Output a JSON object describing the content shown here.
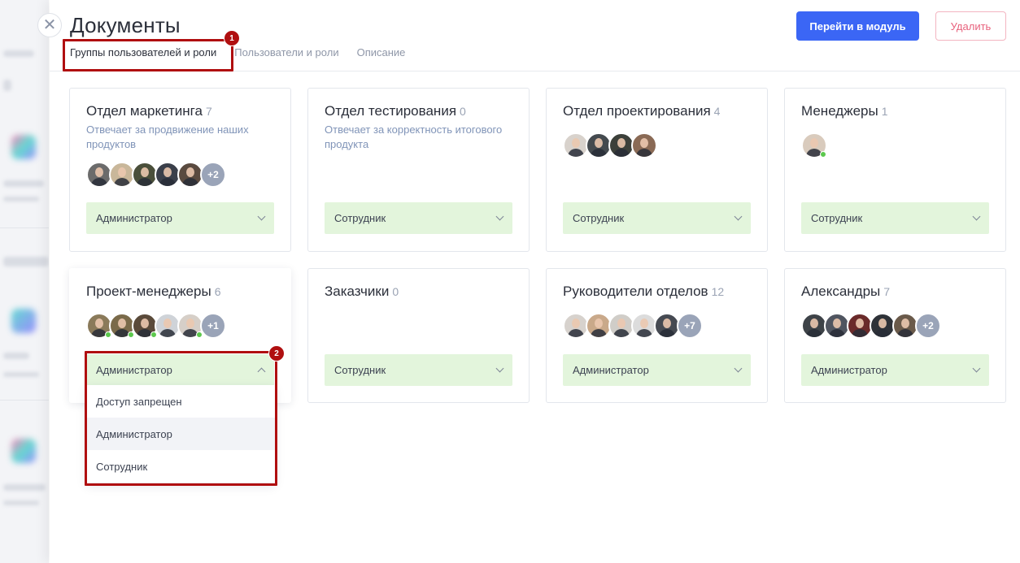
{
  "header": {
    "title": "Документы",
    "primary_button": "Перейти в модуль",
    "delete_button": "Удалить",
    "close_icon": "close-icon"
  },
  "tabs": [
    {
      "label": "Группы пользователей и роли",
      "active": true
    },
    {
      "label": "Пользователи и роли",
      "active": false
    },
    {
      "label": "Описание",
      "active": false
    }
  ],
  "groups": [
    {
      "name": "Отдел маркетинга",
      "count": "7",
      "description": "Отвечает за продвижение наших продуктов",
      "avatars_more": "+2",
      "role": "Администратор"
    },
    {
      "name": "Отдел тестирования",
      "count": "0",
      "description": "Отвечает за корректность итогового продукта",
      "role": "Сотрудник"
    },
    {
      "name": "Отдел проектирования",
      "count": "4",
      "role": "Сотрудник"
    },
    {
      "name": "Менеджеры",
      "count": "1",
      "role": "Сотрудник"
    },
    {
      "name": "Проект-менеджеры",
      "count": "6",
      "avatars_more": "+1",
      "role": "Администратор"
    },
    {
      "name": "Заказчики",
      "count": "0",
      "role": "Сотрудник"
    },
    {
      "name": "Руководители отделов",
      "count": "12",
      "avatars_more": "+7",
      "role": "Администратор"
    },
    {
      "name": "Александры",
      "count": "7",
      "avatars_more": "+2",
      "role": "Администратор"
    }
  ],
  "dropdown": {
    "options": [
      "Доступ запрещен",
      "Администратор",
      "Сотрудник"
    ],
    "selected": "Администратор"
  },
  "annotations": [
    "1",
    "2"
  ],
  "colors": {
    "accent": "#3b66f5",
    "delete": "#e8627d",
    "role_bg": "#e3f5dc",
    "annotation": "#b00f10",
    "online": "#5cc84d"
  }
}
